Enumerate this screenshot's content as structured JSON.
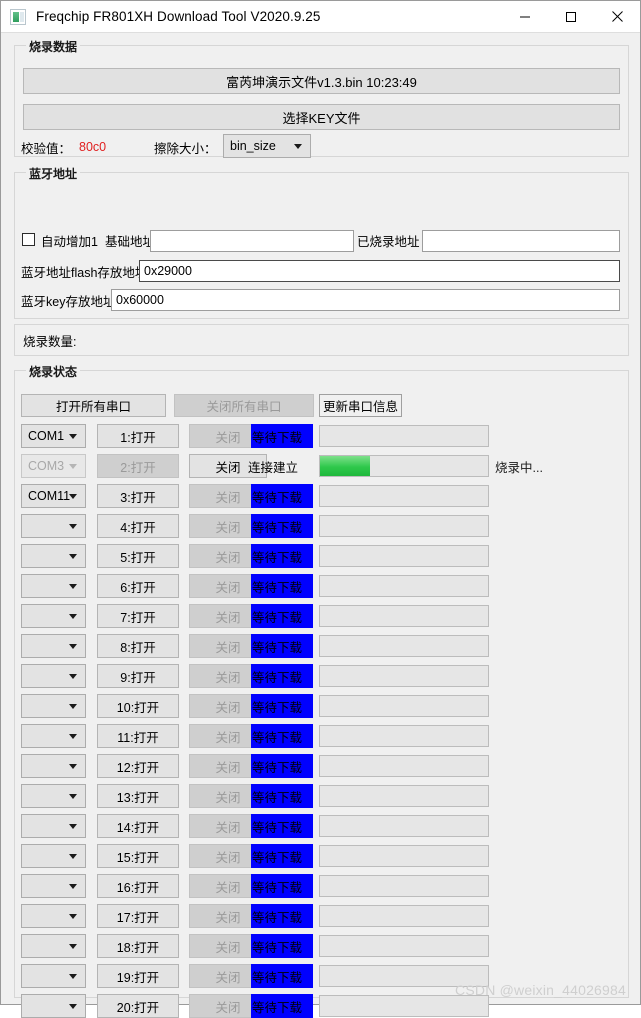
{
  "window": {
    "title": "Freqchip FR801XH Download Tool V2020.9.25",
    "icon": "app-icon",
    "controls": {
      "minimize": "minimize-icon",
      "maximize": "maximize-icon",
      "close": "close-icon"
    }
  },
  "burn_data": {
    "group_label": "烧录数据",
    "bin_file_button": "富芮坤演示文件v1.3.bin        10:23:49",
    "key_file_button": "选择KEY文件",
    "checksum_label": "校验值：",
    "checksum_value": "80c0",
    "checksum_color": "#e02020",
    "erase_size_label": "擦除大小：",
    "erase_size_value": "bin_size",
    "erase_size_options": [
      "bin_size"
    ]
  },
  "bt_address": {
    "group_label": "蓝牙地址",
    "auto_increment_label": "自动增加1",
    "auto_increment_checked": false,
    "base_address_label": "基础地址",
    "base_address_value": "",
    "burned_address_label": "已烧录地址",
    "burned_address_value": "",
    "flash_address_label": "蓝牙地址flash存放地址",
    "flash_address_value": "0x29000",
    "key_address_label": "蓝牙key存放地址",
    "key_address_value": "0x60000"
  },
  "burn_count": {
    "label": "烧录数量:",
    "value": ""
  },
  "burn_status": {
    "group_label": "烧录状态",
    "open_all_button": "打开所有串口",
    "close_all_button": "关闭所有串口",
    "refresh_button": "更新串口信息",
    "rows": [
      {
        "port": "COM1",
        "port_disabled": false,
        "open": "1:打开",
        "open_disabled": false,
        "close": "关闭",
        "close_disabled": true,
        "status": "等待下载",
        "status_style": "waiting",
        "progress": 0,
        "note": ""
      },
      {
        "port": "COM3",
        "port_disabled": true,
        "open": "2:打开",
        "open_disabled": true,
        "close": "关闭",
        "close_disabled": false,
        "status": "连接建立",
        "status_style": "connected",
        "progress": 30,
        "note": "烧录中..."
      },
      {
        "port": "COM11",
        "port_disabled": false,
        "open": "3:打开",
        "open_disabled": false,
        "close": "关闭",
        "close_disabled": true,
        "status": "等待下载",
        "status_style": "waiting",
        "progress": 0,
        "note": ""
      },
      {
        "port": "",
        "port_disabled": false,
        "open": "4:打开",
        "open_disabled": false,
        "close": "关闭",
        "close_disabled": true,
        "status": "等待下载",
        "status_style": "waiting",
        "progress": 0,
        "note": ""
      },
      {
        "port": "",
        "port_disabled": false,
        "open": "5:打开",
        "open_disabled": false,
        "close": "关闭",
        "close_disabled": true,
        "status": "等待下载",
        "status_style": "waiting",
        "progress": 0,
        "note": ""
      },
      {
        "port": "",
        "port_disabled": false,
        "open": "6:打开",
        "open_disabled": false,
        "close": "关闭",
        "close_disabled": true,
        "status": "等待下载",
        "status_style": "waiting",
        "progress": 0,
        "note": ""
      },
      {
        "port": "",
        "port_disabled": false,
        "open": "7:打开",
        "open_disabled": false,
        "close": "关闭",
        "close_disabled": true,
        "status": "等待下载",
        "status_style": "waiting",
        "progress": 0,
        "note": ""
      },
      {
        "port": "",
        "port_disabled": false,
        "open": "8:打开",
        "open_disabled": false,
        "close": "关闭",
        "close_disabled": true,
        "status": "等待下载",
        "status_style": "waiting",
        "progress": 0,
        "note": ""
      },
      {
        "port": "",
        "port_disabled": false,
        "open": "9:打开",
        "open_disabled": false,
        "close": "关闭",
        "close_disabled": true,
        "status": "等待下载",
        "status_style": "waiting",
        "progress": 0,
        "note": ""
      },
      {
        "port": "",
        "port_disabled": false,
        "open": "10:打开",
        "open_disabled": false,
        "close": "关闭",
        "close_disabled": true,
        "status": "等待下载",
        "status_style": "waiting",
        "progress": 0,
        "note": ""
      },
      {
        "port": "",
        "port_disabled": false,
        "open": "11:打开",
        "open_disabled": false,
        "close": "关闭",
        "close_disabled": true,
        "status": "等待下载",
        "status_style": "waiting",
        "progress": 0,
        "note": ""
      },
      {
        "port": "",
        "port_disabled": false,
        "open": "12:打开",
        "open_disabled": false,
        "close": "关闭",
        "close_disabled": true,
        "status": "等待下载",
        "status_style": "waiting",
        "progress": 0,
        "note": ""
      },
      {
        "port": "",
        "port_disabled": false,
        "open": "13:打开",
        "open_disabled": false,
        "close": "关闭",
        "close_disabled": true,
        "status": "等待下载",
        "status_style": "waiting",
        "progress": 0,
        "note": ""
      },
      {
        "port": "",
        "port_disabled": false,
        "open": "14:打开",
        "open_disabled": false,
        "close": "关闭",
        "close_disabled": true,
        "status": "等待下载",
        "status_style": "waiting",
        "progress": 0,
        "note": ""
      },
      {
        "port": "",
        "port_disabled": false,
        "open": "15:打开",
        "open_disabled": false,
        "close": "关闭",
        "close_disabled": true,
        "status": "等待下载",
        "status_style": "waiting",
        "progress": 0,
        "note": ""
      },
      {
        "port": "",
        "port_disabled": false,
        "open": "16:打开",
        "open_disabled": false,
        "close": "关闭",
        "close_disabled": true,
        "status": "等待下载",
        "status_style": "waiting",
        "progress": 0,
        "note": ""
      },
      {
        "port": "",
        "port_disabled": false,
        "open": "17:打开",
        "open_disabled": false,
        "close": "关闭",
        "close_disabled": true,
        "status": "等待下载",
        "status_style": "waiting",
        "progress": 0,
        "note": ""
      },
      {
        "port": "",
        "port_disabled": false,
        "open": "18:打开",
        "open_disabled": false,
        "close": "关闭",
        "close_disabled": true,
        "status": "等待下载",
        "status_style": "waiting",
        "progress": 0,
        "note": ""
      },
      {
        "port": "",
        "port_disabled": false,
        "open": "19:打开",
        "open_disabled": false,
        "close": "关闭",
        "close_disabled": true,
        "status": "等待下载",
        "status_style": "waiting",
        "progress": 0,
        "note": ""
      },
      {
        "port": "",
        "port_disabled": false,
        "open": "20:打开",
        "open_disabled": false,
        "close": "关闭",
        "close_disabled": true,
        "status": "等待下载",
        "status_style": "waiting",
        "progress": 0,
        "note": ""
      }
    ]
  },
  "watermark": "CSDN @weixin_44026984"
}
